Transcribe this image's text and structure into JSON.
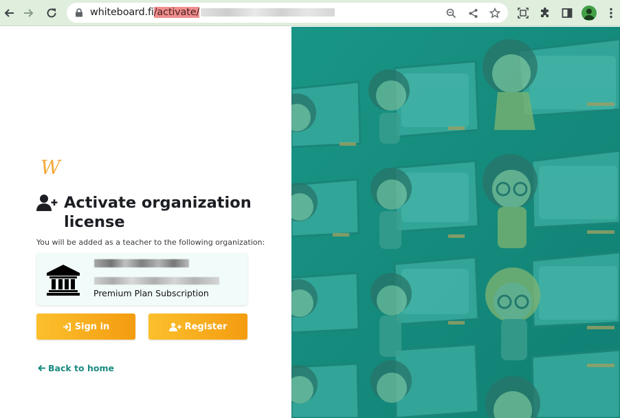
{
  "browser": {
    "url_host": "whiteboard.fi",
    "url_path": "/activate/",
    "icons": [
      "back-arrow-icon",
      "forward-arrow-icon",
      "reload-icon",
      "lock-icon",
      "zoom-icon",
      "share-icon",
      "star-icon",
      "screenshot-icon",
      "extensions-icon",
      "side-panel-icon",
      "profile-icon",
      "menu-icon"
    ]
  },
  "page": {
    "logo": "W",
    "title": "Activate organization license",
    "subtitle": "You will be added as a teacher to the following organization:",
    "org": {
      "plan": "Premium Plan Subscription"
    },
    "buttons": {
      "signin": "Sign in",
      "register": "Register"
    },
    "back_link": "Back to home"
  },
  "colors": {
    "accent": "#f3a93a",
    "button_start": "#fbc02d",
    "button_end": "#f49c10",
    "link": "#1a8a80",
    "illustration_bg": "#148a7c",
    "chrome_bg": "#dfeedd"
  }
}
